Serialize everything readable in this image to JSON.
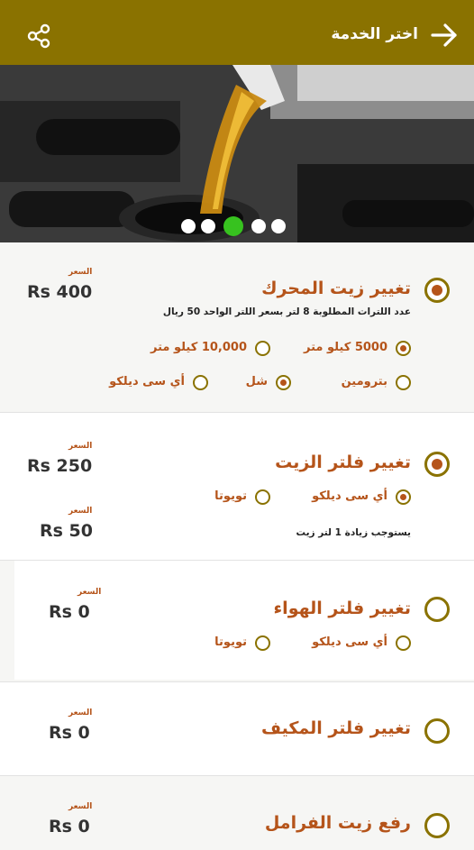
{
  "header": {
    "title": "اختر الخدمة",
    "back_icon": "arrow-right-icon",
    "share_icon": "share-icon",
    "bg": "#8a7200"
  },
  "hero": {
    "image": "engine-oil-pour-photo",
    "slides": [
      false,
      false,
      true,
      false,
      false
    ]
  },
  "colors": {
    "accent": "#b5541a",
    "primary": "#8a7200",
    "dot_active": "#37c21f"
  },
  "services": [
    {
      "title": "تغيير زيت المحرك",
      "selected": true,
      "price_label": "السعر",
      "price": "Rs 400",
      "note": "عدد اللترات المطلوبة 8 لتر بسعر اللتر الواحد 50 ريال",
      "options_row1": [
        {
          "label": "5000 كيلو متر",
          "selected": true
        },
        {
          "label": "10,000 كيلو متر",
          "selected": false
        }
      ],
      "options_row2": [
        {
          "label": "بترومين",
          "selected": false
        },
        {
          "label": "شل",
          "selected": true
        },
        {
          "label": "أي سى ديلكو",
          "selected": false
        }
      ]
    },
    {
      "title": "تغيير فلتر الزيت",
      "selected": true,
      "price_label": "السعر",
      "price": "Rs 250",
      "options": [
        {
          "label": "أي سى ديلكو",
          "selected": true
        },
        {
          "label": "تويوتا",
          "selected": false
        }
      ],
      "extra_price_label": "السعر",
      "extra_price": "Rs 50",
      "extra_note": "يستوجب زيادة 1 لتر زيت"
    },
    {
      "title": "تغيير فلتر الهواء",
      "selected": false,
      "price_label": "السعر",
      "price": "Rs 0",
      "options": [
        {
          "label": "أي سى ديلكو",
          "selected": false
        },
        {
          "label": "تويوتا",
          "selected": false
        }
      ]
    },
    {
      "title": "تغيير فلتر المكيف",
      "selected": false,
      "price_label": "السعر",
      "price": "Rs 0"
    },
    {
      "title": "رفع زيت الفرامل",
      "selected": false,
      "price_label": "السعر",
      "price": "Rs 0"
    }
  ]
}
